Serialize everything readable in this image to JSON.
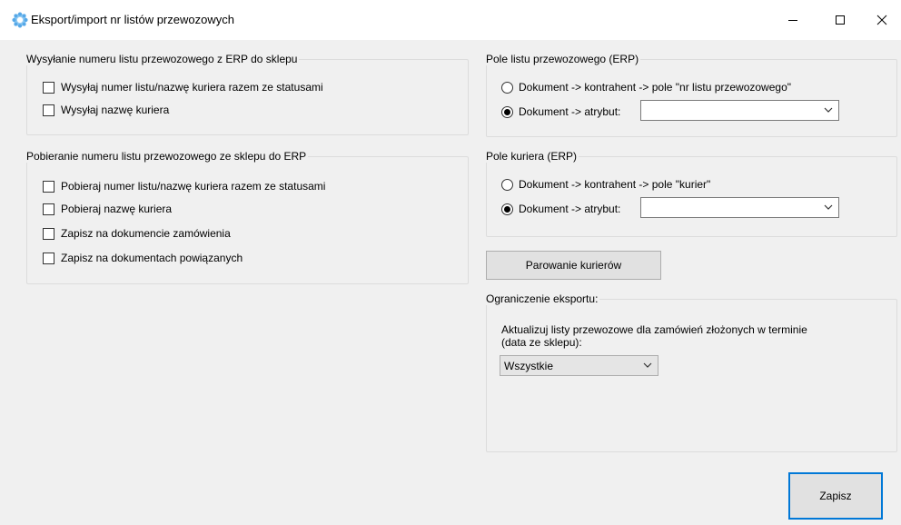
{
  "window": {
    "title": "Eksport/import nr listów przewozowych",
    "controls": [
      "minimize-icon",
      "maximize-icon",
      "close-icon"
    ]
  },
  "send_group": {
    "title": "Wysyłanie numeru listu przewozowego z ERP do sklepu",
    "options": [
      {
        "label": "Wysyłaj numer listu/nazwę kuriera razem ze statusami",
        "checked": false
      },
      {
        "label": "Wysyłaj nazwę kuriera",
        "checked": false
      }
    ]
  },
  "fetch_group": {
    "title": "Pobieranie numeru listu przewozowego ze sklepu do ERP",
    "options": [
      {
        "label": "Pobieraj numer listu/nazwę kuriera razem ze statusami",
        "checked": false
      },
      {
        "label": "Pobieraj nazwę kuriera",
        "checked": false
      },
      {
        "label": "Zapisz na dokumencie zamówienia",
        "checked": false
      },
      {
        "label": "Zapisz na dokumentach powiązanych",
        "checked": false
      }
    ]
  },
  "waybill_field": {
    "title": "Pole listu przewozowego (ERP)",
    "option1": "Dokument -> kontrahent -> pole \"nr listu przewozowego\"",
    "option2": "Dokument -> atrybut:",
    "selected": "option2",
    "attribute_value": ""
  },
  "courier_field": {
    "title": "Pole kuriera (ERP)",
    "option1": "Dokument -> kontrahent -> pole \"kurier\"",
    "option2": "Dokument -> atrybut:",
    "selected": "option2",
    "attribute_value": ""
  },
  "pairing_button": "Parowanie kurierów",
  "export_limit": {
    "title": "Ograniczenie eksportu:",
    "description_line1": "Aktualizuj listy przewozowe dla zamówień złożonych w terminie",
    "description_line2": "(data ze sklepu):",
    "selected": "Wszystkie"
  },
  "save_button": "Zapisz",
  "colors": {
    "accent": "#0078d7",
    "icon": "#56a8e8"
  }
}
